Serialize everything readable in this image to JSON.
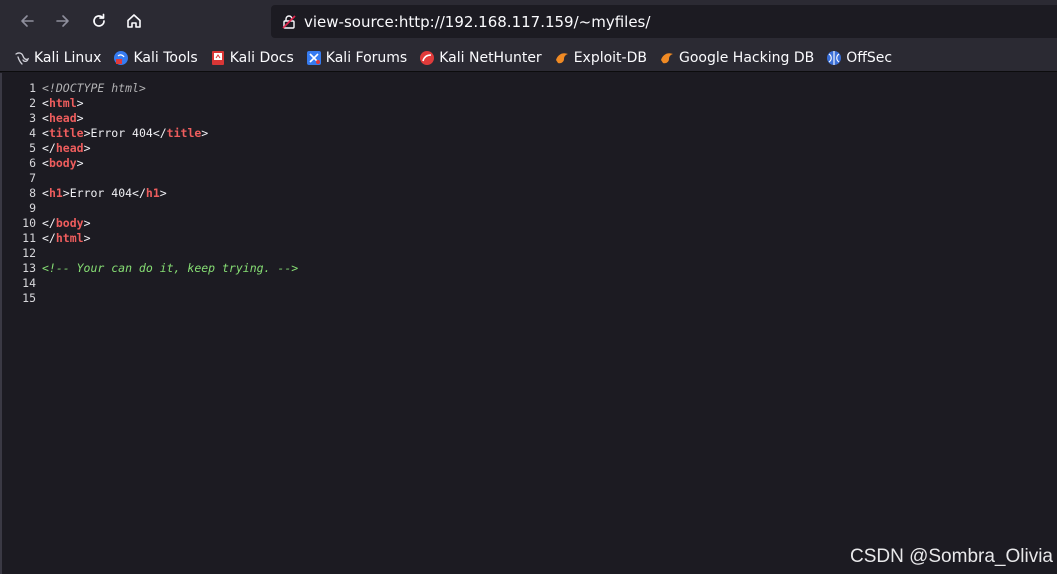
{
  "toolbar": {
    "back_icon": "arrow-left-icon",
    "forward_icon": "arrow-right-icon",
    "reload_icon": "reload-icon",
    "home_icon": "home-icon",
    "url": "view-source:http://192.168.117.159/~myfiles/"
  },
  "bookmarks": [
    {
      "label": "Kali Linux",
      "icon": "kali-dragon-icon"
    },
    {
      "label": "Kali Tools",
      "icon": "kali-tools-icon"
    },
    {
      "label": "Kali Docs",
      "icon": "kali-docs-icon"
    },
    {
      "label": "Kali Forums",
      "icon": "kali-forums-icon"
    },
    {
      "label": "Kali NetHunter",
      "icon": "nethunter-icon"
    },
    {
      "label": "Exploit-DB",
      "icon": "exploit-db-icon"
    },
    {
      "label": "Google Hacking DB",
      "icon": "ghdb-icon"
    },
    {
      "label": "OffSec",
      "icon": "offsec-icon"
    }
  ],
  "source": {
    "line_numbers": [
      "1",
      "2",
      "3",
      "4",
      "5",
      "6",
      "7",
      "8",
      "9",
      "10",
      "11",
      "12",
      "13",
      "14",
      "15"
    ],
    "doctype": "<!DOCTYPE html>",
    "tag_html": "html",
    "tag_head": "head",
    "tag_title": "title",
    "title_text": "Error 404",
    "tag_body": "body",
    "tag_h1": "h1",
    "h1_text": "Error 404",
    "comment": "<!-- Your can do it, keep trying. -->"
  },
  "watermark": "CSDN @Sombra_Olivia",
  "colors": {
    "toolbar_bg": "#2b2a33",
    "page_bg": "#1c1b22",
    "tag": "#ee5d5d",
    "comment": "#86de74"
  }
}
